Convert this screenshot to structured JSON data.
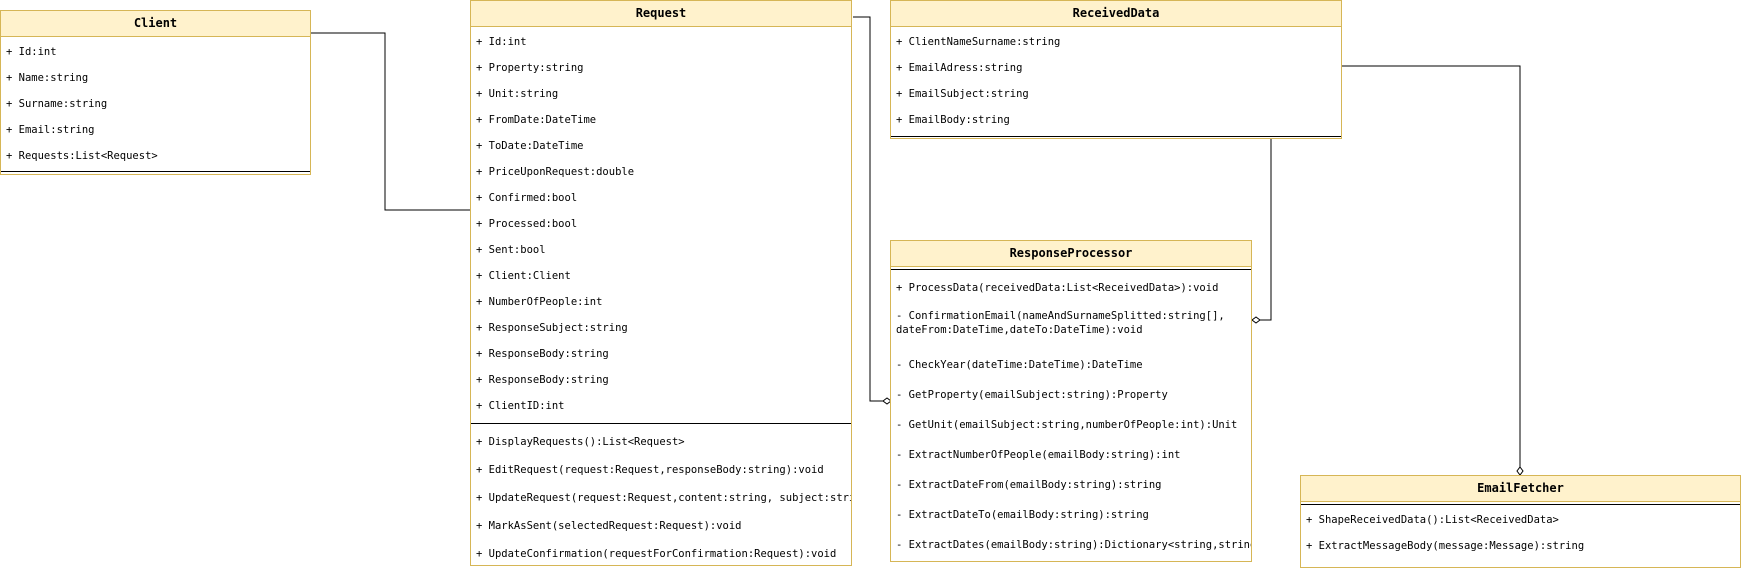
{
  "diagram": {
    "colors": {
      "header_fill": "#fff2cc",
      "border": "#d6b656",
      "line": "#000000"
    },
    "classes": {
      "client": {
        "name": "Client",
        "attributes": [
          "+ Id:int",
          "+ Name:string",
          "+ Surname:string",
          "+ Email:string",
          "+ Requests:List<Request>"
        ],
        "methods": []
      },
      "request": {
        "name": "Request",
        "attributes": [
          "+ Id:int",
          "+ Property:string",
          "+ Unit:string",
          "+ FromDate:DateTime",
          "+ ToDate:DateTime",
          "+ PriceUponRequest:double",
          "+ Confirmed:bool",
          "+ Processed:bool",
          "+ Sent:bool",
          "+ Client:Client",
          "+ NumberOfPeople:int",
          "+ ResponseSubject:string",
          "+ ResponseBody:string",
          "+ ResponseBody:string",
          "+ ClientID:int"
        ],
        "methods": [
          "+ DisplayRequests():List<Request>",
          "+ EditRequest(request:Request,responseBody:string):void",
          "+ UpdateRequest(request:Request,content:string, subject:string",
          "+ MarkAsSent(selectedRequest:Request):void",
          "+ UpdateConfirmation(requestForConfirmation:Request):void"
        ]
      },
      "received_data": {
        "name": "ReceivedData",
        "attributes": [
          "+ ClientNameSurname:string",
          "+ EmailAdress:string",
          "+ EmailSubject:string",
          "+ EmailBody:string"
        ],
        "methods": []
      },
      "response_processor": {
        "name": "ResponseProcessor",
        "attributes": [],
        "methods": [
          "+ ProcessData(receivedData:List<ReceivedData>):void",
          "- ConfirmationEmail(nameAndSurnameSplitted:string[], dateFrom:DateTime,dateTo:DateTime):void",
          "- CheckYear(dateTime:DateTime):DateTime",
          "- GetProperty(emailSubject:string):Property",
          "- GetUnit(emailSubject:string,numberOfPeople:int):Unit",
          "- ExtractNumberOfPeople(emailBody:string):int",
          "- ExtractDateFrom(emailBody:string):string",
          "- ExtractDateTo(emailBody:string):string",
          "- ExtractDates(emailBody:string):Dictionary<string,string>"
        ]
      },
      "email_fetcher": {
        "name": "EmailFetcher",
        "attributes": [],
        "methods": [
          "+ ShapeReceivedData():List<ReceivedData>",
          "+ ExtractMessageBody(message:Message):string"
        ]
      }
    }
  }
}
